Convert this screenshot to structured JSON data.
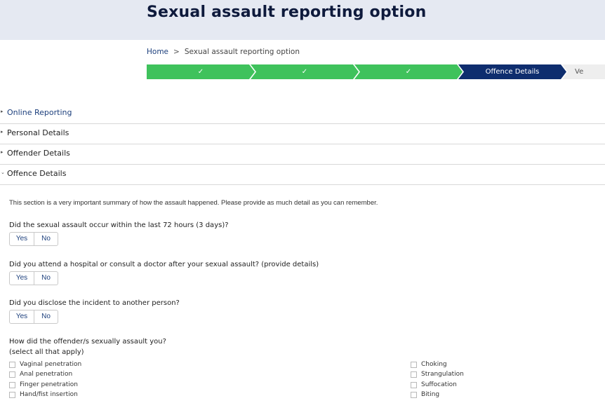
{
  "header": {
    "title": "Sexual assault reporting option"
  },
  "breadcrumb": {
    "home": "Home",
    "separator": ">",
    "current": "Sexual assault reporting option"
  },
  "progress": {
    "completed_mark": "✓",
    "current_label": "Offence Details",
    "next_label_partial": "Ve",
    "colors": {
      "completed": "#3fc25c",
      "current": "#0e2d6e",
      "pending": "#eeeeee"
    }
  },
  "sections": [
    {
      "label": "Online Reporting",
      "arrow": "▸"
    },
    {
      "label": "Personal Details",
      "arrow": "▸"
    },
    {
      "label": "Offender Details",
      "arrow": "▸"
    },
    {
      "label": "Offence Details",
      "arrow": "⌄"
    }
  ],
  "offence": {
    "intro": "This section is a very important summary of how the assault happened. Please provide as much detail as you can remember.",
    "questions": [
      {
        "text": "Did the sexual assault occur within the last 72 hours (3 days)?",
        "yes": "Yes",
        "no": "No"
      },
      {
        "text": "Did you attend a hospital or consult a doctor after your sexual assault? (provide details)",
        "yes": "Yes",
        "no": "No"
      },
      {
        "text": "Did you disclose the incident to another person?",
        "yes": "Yes",
        "no": "No"
      }
    ],
    "how_question": "How did the offender/s sexually assault you?",
    "how_hint": "(select all that apply)",
    "options_left": [
      "Vaginal penetration",
      "Anal penetration",
      "Finger penetration",
      "Hand/fist insertion"
    ],
    "options_right": [
      "Choking",
      "Strangulation",
      "Suffocation",
      "Biting"
    ]
  }
}
